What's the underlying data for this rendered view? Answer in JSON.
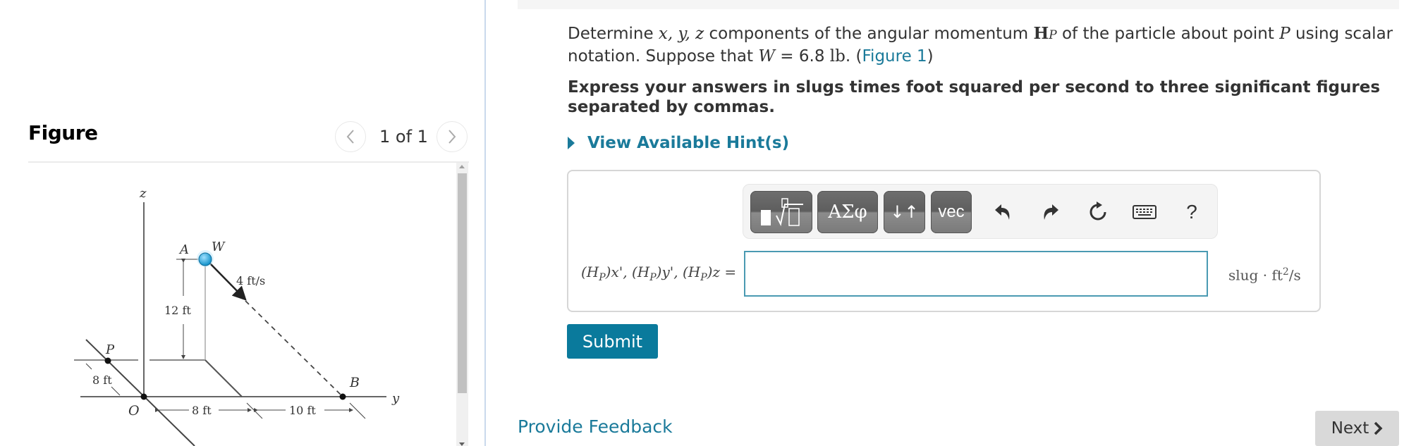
{
  "figure_panel": {
    "title": "Figure",
    "pager": "1 of 1",
    "prev_icon": "chevron-left-icon",
    "next_icon": "chevron-right-icon",
    "diagram": {
      "axis_labels": {
        "z": "z",
        "y": "y"
      },
      "point_labels": {
        "A": "A",
        "W": "W",
        "P": "P",
        "O": "O",
        "B": "B"
      },
      "velocity_label": "4 ft/s",
      "dimensions": {
        "height": "12 ft",
        "p_offset": "8 ft",
        "oy_to_a": "8 ft",
        "a_to_b": "10 ft"
      },
      "particle_color": "#29a8e0"
    }
  },
  "question": {
    "text_1": "Determine ",
    "math_xyz": "x, y, z",
    "text_2": " components of the angular momentum ",
    "math_H": "H",
    "math_Hsub": "P",
    "text_3": " of the particle about point ",
    "math_P": "P",
    "text_4": " using scalar notation. Suppose that ",
    "math_W": "W",
    "text_5": " = 6.8 ",
    "math_lb": "lb",
    "text_6": ". (",
    "figure_link": "Figure 1",
    "text_7": ")"
  },
  "instruction": "Express your answers in slugs times foot squared per second to three significant figures separated by commas.",
  "hint_label": "View Available Hint(s)",
  "toolbar": {
    "buttons": [
      {
        "name": "templates-button",
        "label": "▮∜▭"
      },
      {
        "name": "greek-symbols-button",
        "label": "ΑΣφ"
      },
      {
        "name": "sort-button",
        "label": "↓↑"
      },
      {
        "name": "vector-button",
        "label": "vec"
      }
    ],
    "icons": [
      "undo-icon",
      "redo-icon",
      "reset-icon",
      "keyboard-icon",
      "help-icon"
    ],
    "help_label": "?"
  },
  "answer": {
    "label_H": "(H",
    "label_sub_P": "P",
    "label_x": ")x',",
    "label_y": ")y',",
    "label_z": ")z",
    "equals": "=",
    "value": "",
    "placeholder": "",
    "unit_main": "slug · ft",
    "unit_exp": "2",
    "unit_tail": "/s"
  },
  "submit_label": "Submit",
  "feedback_label": "Provide Feedback",
  "next_label": "Next",
  "colors": {
    "accent": "#0a7a9c",
    "link": "#1a7a9a",
    "next_bg": "#d9d9d9"
  }
}
